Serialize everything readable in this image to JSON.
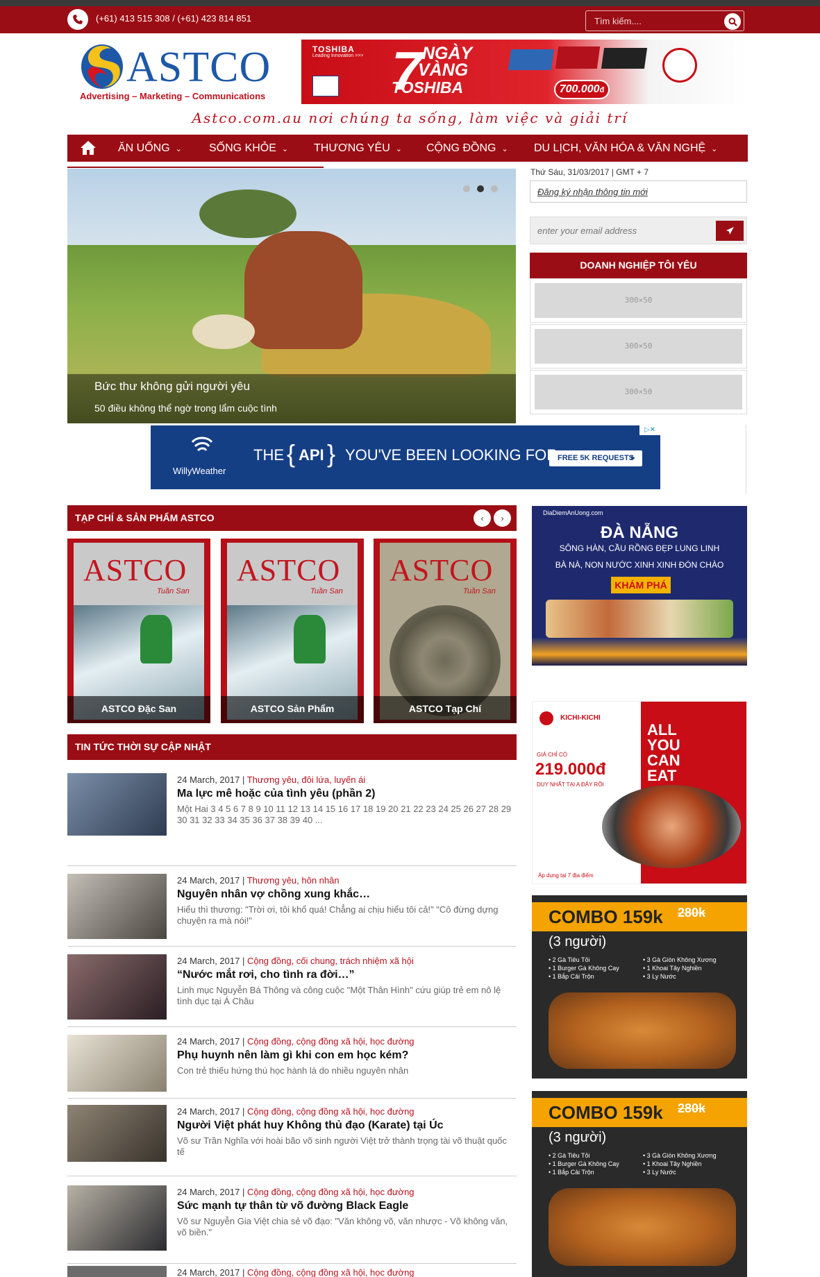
{
  "topbar": {
    "phone": "(+61) 413 515 308 / (+61) 423 814 851",
    "search_placeholder": "Tìm kiếm...."
  },
  "header": {
    "logo_text": "ASTCO",
    "logo_tagline": "Advertising – Marketing – Communications",
    "tagline": "Astco.com.au nơi chúng ta sống, làm việc và giải trí",
    "banner_ad": {
      "brand": "TOSHIBA",
      "brand_sub": "Leading Innovation >>>",
      "headline_1": "NGÀY",
      "headline_2": "VÀNG",
      "headline_3": "TOSHIBA",
      "number": "7",
      "price": "700.000",
      "price_unit": "đ"
    }
  },
  "nav": {
    "items": [
      {
        "label": "ĂN UỐNG"
      },
      {
        "label": "SỐNG KHỎE"
      },
      {
        "label": "THƯƠNG YÊU"
      },
      {
        "label": "CỘNG ĐỒNG"
      },
      {
        "label": "DU LỊCH, VĂN HÓA & VĂN NGHỆ"
      }
    ]
  },
  "slider": {
    "title": "Bức thư không gửi người yêu",
    "subtitle": "50 điều không thể ngờ trong lẩm cuộc tình"
  },
  "sidebar": {
    "date": "Thứ Sáu, 31/03/2017 | GMT + 7",
    "subscribe_link": "Đăng ký nhận thông tin mới",
    "email_placeholder": "enter your email address",
    "biz_header": "DOANH NGHIỆP TÔI YÊU",
    "biz_slot_label": "300×50"
  },
  "wide_ad": {
    "brand": "WillyWeather",
    "text_before": "THE",
    "text_api": "API",
    "text_after": "YOU'VE BEEN LOOKING FOR",
    "cta": "FREE 5K REQUESTS"
  },
  "magazines": {
    "section_title": "TẠP CHÍ & SẢN PHẨM ASTCO",
    "issue_sub": "Tuần San",
    "items": [
      {
        "caption": "ASTCO Đặc San"
      },
      {
        "caption": "ASTCO Sản Phẩm"
      },
      {
        "caption": "ASTCO Tạp Chí"
      }
    ]
  },
  "news": {
    "section_title": "TIN TỨC THỜI SỰ CẬP NHẬT",
    "items": [
      {
        "date": "24 March, 2017",
        "cats": "Thương yêu, đôi lứa, luyến ái",
        "title": "Ma lực mê hoặc của tình yêu (phần 2)",
        "desc": "Một Hai 3 4 5 6 7 8 9 10 11 12 13 14 15 16 17 18 19 20 21 22 23 24 25 26 27 28 29 30 31 32 33 34 35 36 37 38 39 40 ..."
      },
      {
        "date": "24 March, 2017",
        "cats": "Thương yêu, hôn nhân",
        "title": "Nguyên nhân vợ chồng xung khắc…",
        "desc": "Hiểu thì thương: \"Trời ơi, tôi khổ quá! Chẳng ai chịu hiểu tôi cả!\" \"Cô đừng dựng chuyện ra mà nói!\""
      },
      {
        "date": "24 March, 2017",
        "cats": "Cộng đồng, cối chung, trách nhiệm xã hội",
        "title": "“Nước mắt rơi, cho tình ra đời…”",
        "desc": "Linh mục Nguyễn Bá Thông và công cuộc \"Một Thân Hình\" cứu giúp trẻ em nô lệ tình dục tại Á Châu"
      },
      {
        "date": "24 March, 2017",
        "cats": "Cộng đồng, cộng đồng xã hội, học đường",
        "title": "Phụ huynh nên làm gì khi con em học kém?",
        "desc": "Con trẻ thiếu hứng thú học hành là do nhiều nguyên nhân"
      },
      {
        "date": "24 March, 2017",
        "cats": "Cộng đồng, cộng đồng xã hội, học đường",
        "title": "Người Việt phát huy Không thủ đạo (Karate) tại Úc",
        "desc": "Võ sư Trần Nghĩa với hoài bão võ sinh người Việt trở thành trọng tài võ thuật quốc tế"
      },
      {
        "date": "24 March, 2017",
        "cats": "Cộng đồng, cộng đồng xã hội, học đường",
        "title": "Sức mạnh tự thân từ võ đường Black Eagle",
        "desc": "Võ sư Nguyễn Gia Việt chia sẻ võ đạo: \"Văn không võ, văn nhược - Võ không văn, võ biền.\""
      },
      {
        "date": "24 March, 2017",
        "cats": "Cộng đồng, cộng đồng xã hội, học đường",
        "title": "",
        "desc": ""
      }
    ]
  },
  "side_ads": {
    "danang": {
      "brand": "DiaDiemAnUong.com",
      "title": "ĐÀ NẴNG",
      "line1": "SÔNG HÀN, CẦU RỒNG ĐẸP LUNG LINH",
      "line2": "BÀ NÀ, NON NƯỚC XINH XINH ĐÓN CHÀO",
      "cta": "KHÁM PHÁ"
    },
    "kichi": {
      "brand": "KICHI-KICHI",
      "price_label": "GIÁ CHỈ CÓ",
      "price": "219.000đ",
      "price_note": "DUY NHẤT TẠI A ĐÂY RỒI",
      "big_1": "ALL",
      "big_2": "YOU",
      "big_3": "CAN",
      "big_4": "EAT",
      "footer": "Áp dụng tại 7 địa điểm"
    },
    "combo": {
      "title": "COMBO 159k",
      "old_price": "280k",
      "persons": "(3 người)",
      "col1": [
        "• 2 Gà Tiêu Tỏi",
        "• 1 Burger Gà Không Cay",
        "• 1 Bắp Cải Trộn"
      ],
      "col2": [
        "• 3 Gà Giòn Không Xương",
        "• 1 Khoai Tây Nghiền",
        "• 3 Ly Nước"
      ]
    }
  }
}
